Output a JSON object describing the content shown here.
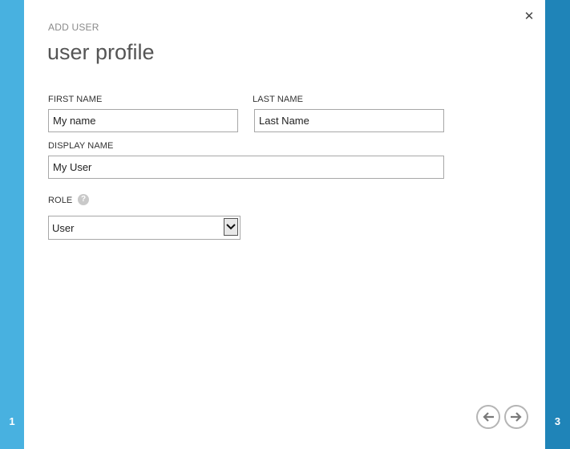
{
  "wizard": {
    "current_step_left": "1",
    "current_step_right": "3"
  },
  "dialog": {
    "eyebrow": "ADD USER",
    "title": "user profile",
    "close_icon": "close-icon"
  },
  "form": {
    "first_name": {
      "label": "FIRST NAME",
      "value": "My name"
    },
    "last_name": {
      "label": "LAST NAME",
      "value": "Last Name"
    },
    "display_name": {
      "label": "DISPLAY NAME",
      "value": "My User"
    },
    "role": {
      "label": "ROLE",
      "help_icon": "question-mark-icon",
      "selected": "User"
    }
  },
  "navigation": {
    "back_icon": "arrow-left-icon",
    "next_icon": "arrow-right-icon"
  },
  "colors": {
    "left_rail": "#48b1e0",
    "right_rail": "#1f84b8"
  }
}
